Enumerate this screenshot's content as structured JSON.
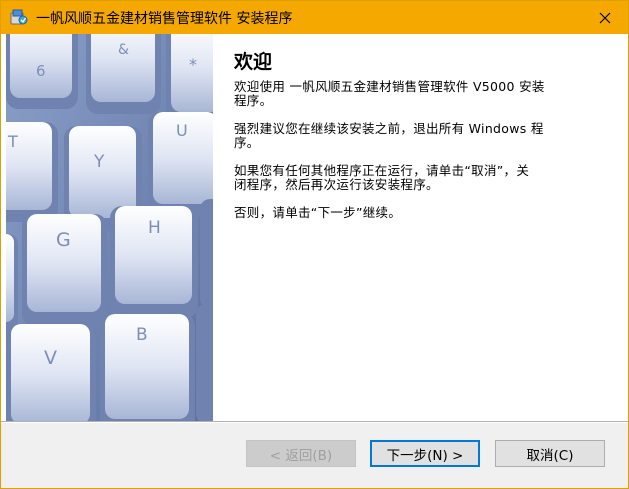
{
  "window": {
    "title": "一帆风顺五金建材销售管理软件 安装程序",
    "app_icon": "installer-icon",
    "close_icon": "close-icon"
  },
  "welcome": {
    "title": "欢迎",
    "para1_line1": "欢迎使用 一帆风顺五金建材销售管理软件 V5000 安装",
    "para1_line2": "程序。",
    "para2_line1": "强烈建议您在继续该安装之前，退出所有 Windows 程",
    "para2_line2": "序。",
    "para3_line1": "如果您有任何其他程序正在运行，请单击“取消”，关",
    "para3_line2": "闭程序，然后再次运行该安装程序。",
    "para4": "否则，请单击“下一步”继续。"
  },
  "keys": [
    "6",
    "&",
    "*",
    "T",
    "Y",
    "U",
    "G",
    "H",
    "V",
    "B"
  ],
  "buttons": {
    "back": "< 返回(B)",
    "next": "下一步(N) >",
    "cancel": "取消(C)"
  },
  "colors": {
    "titlebar": "#f5a800",
    "accent": "#0078d7"
  }
}
